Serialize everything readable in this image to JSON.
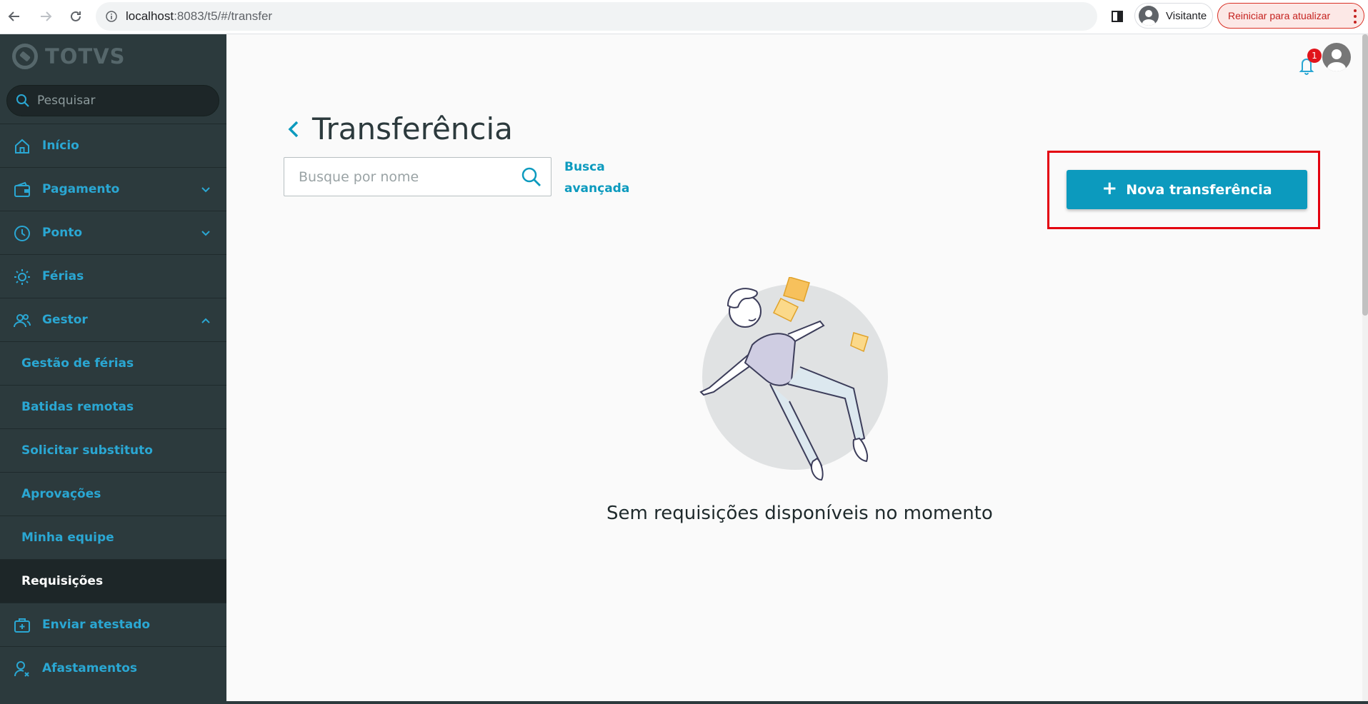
{
  "browser": {
    "url_host": "localhost",
    "url_path": ":8083/t5/#/transfer",
    "profile_name": "Visitante",
    "update_label": "Reiniciar para atualizar"
  },
  "sidebar": {
    "logo_text": "TOTVS",
    "search_placeholder": "Pesquisar",
    "items": [
      {
        "label": "Início",
        "icon": "home-icon"
      },
      {
        "label": "Pagamento",
        "icon": "wallet-icon",
        "chevron": "down"
      },
      {
        "label": "Ponto",
        "icon": "clock-icon",
        "chevron": "down"
      },
      {
        "label": "Férias",
        "icon": "sun-icon"
      },
      {
        "label": "Gestor",
        "icon": "users-icon",
        "chevron": "up"
      },
      {
        "label": "Gestão de férias"
      },
      {
        "label": "Batidas remotas"
      },
      {
        "label": "Solicitar substituto"
      },
      {
        "label": "Aprovações"
      },
      {
        "label": "Minha equipe"
      },
      {
        "label": "Requisições",
        "active": true
      },
      {
        "label": "Enviar atestado",
        "icon": "medical-kit-icon"
      },
      {
        "label": "Afastamentos",
        "icon": "user-remove-icon"
      }
    ]
  },
  "header": {
    "notification_count": "1"
  },
  "page": {
    "title": "Transferência",
    "search_placeholder": "Busque por nome",
    "advanced_search_line1": "Busca",
    "advanced_search_line2": "avançada",
    "new_button_label": "Nova transferência",
    "empty_message": "Sem requisições disponíveis no momento"
  },
  "colors": {
    "sidebar_bg": "#2c3a3d",
    "accent": "#0c9abe",
    "highlight_border": "#e3000f",
    "badge": "#e1141b"
  }
}
